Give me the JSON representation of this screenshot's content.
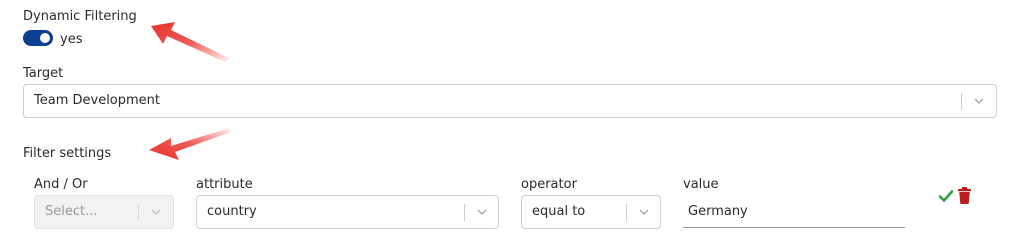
{
  "dynamic_filtering": {
    "label": "Dynamic Filtering",
    "toggle_on": true,
    "toggle_text": "yes"
  },
  "target": {
    "label": "Target",
    "value": "Team Development"
  },
  "filter_settings": {
    "label": "Filter settings",
    "columns": {
      "and_or": "And / Or",
      "attribute": "attribute",
      "operator": "operator",
      "value": "value"
    },
    "row": {
      "and_or_placeholder": "Select...",
      "attribute": "country",
      "operator": "equal to",
      "value": "Germany"
    }
  },
  "icons": {
    "confirm": "check-icon",
    "delete": "trash-icon",
    "annotation": "red-arrow-icon"
  },
  "colors": {
    "toggle": "#0b3f91",
    "check": "#2e9e3e",
    "trash": "#b91d1d",
    "arrow": "#e8312a"
  }
}
